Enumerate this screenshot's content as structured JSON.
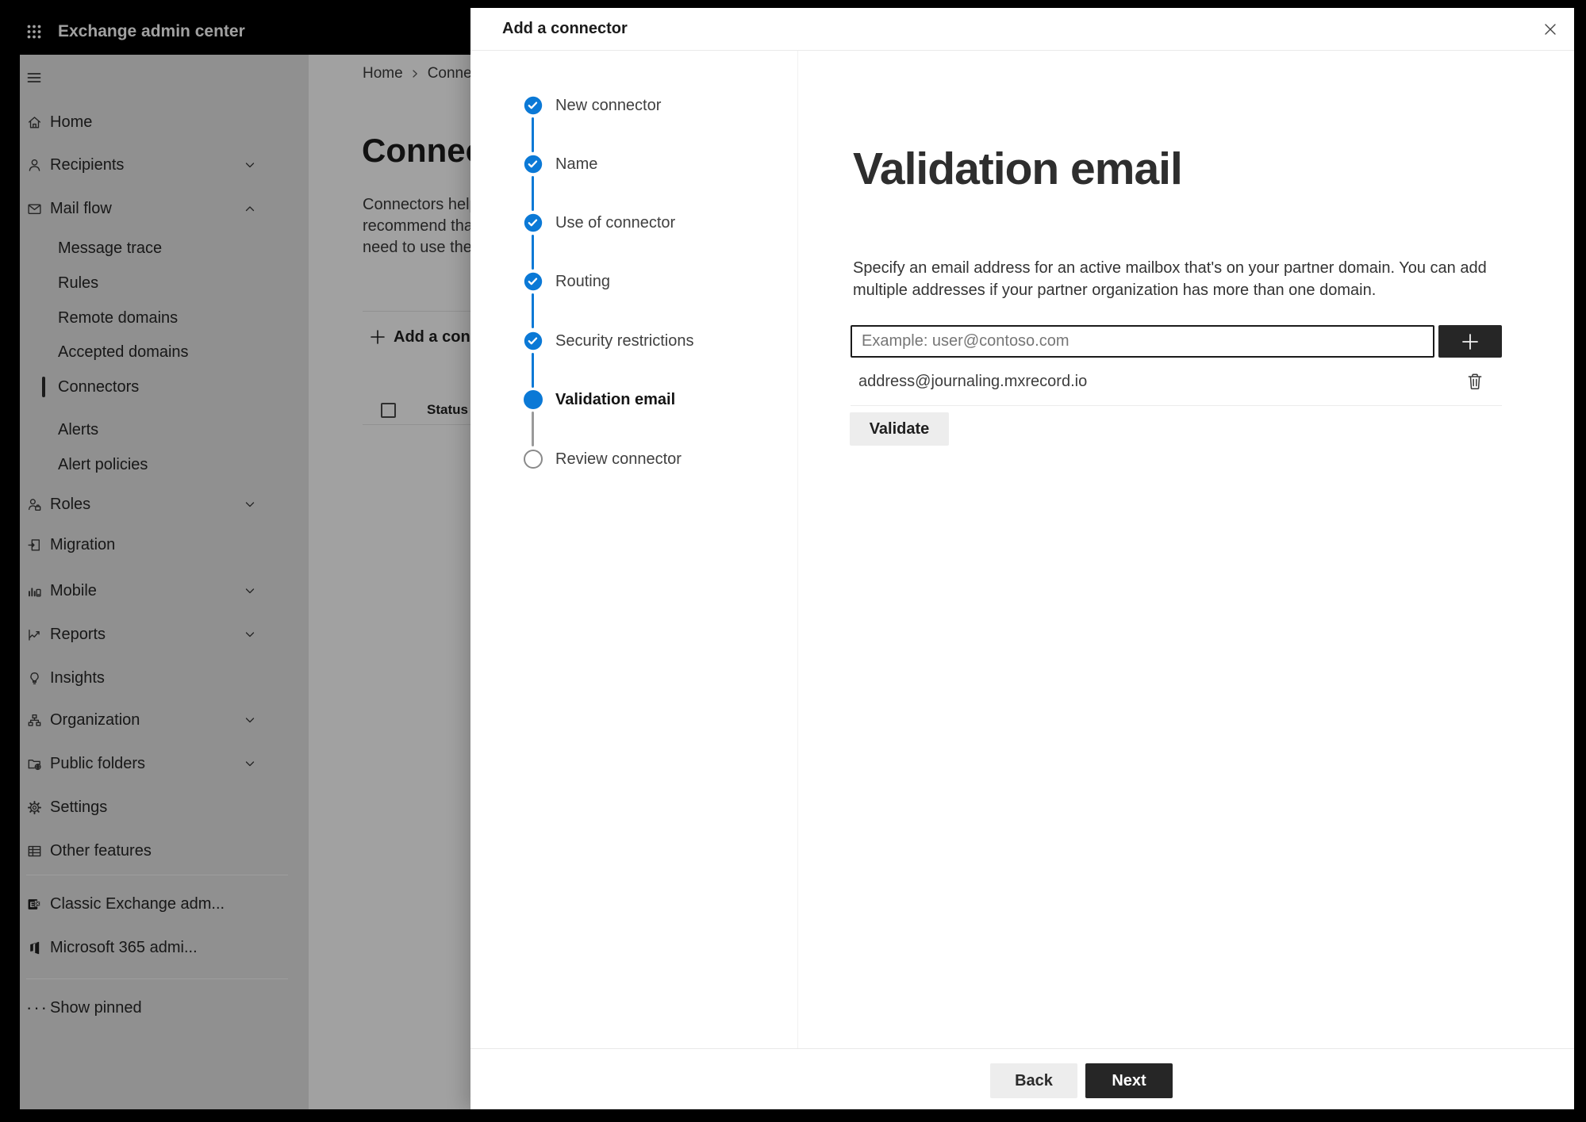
{
  "chrome": {
    "topbar_title": "Exchange admin center"
  },
  "sidebar": {
    "items": [
      {
        "label": "Home",
        "icon": "home-icon"
      },
      {
        "label": "Recipients",
        "icon": "person-icon",
        "chevron": "down"
      },
      {
        "label": "Mail flow",
        "icon": "mail-icon",
        "chevron": "up",
        "expanded": true
      },
      {
        "label": "Message trace",
        "indent": true
      },
      {
        "label": "Rules",
        "indent": true
      },
      {
        "label": "Remote domains",
        "indent": true
      },
      {
        "label": "Accepted domains",
        "indent": true
      },
      {
        "label": "Connectors",
        "indent": true,
        "selected": true
      },
      {
        "label": "Alerts",
        "indent": true
      },
      {
        "label": "Alert policies",
        "indent": true
      },
      {
        "label": "Roles",
        "icon": "roles-icon",
        "chevron": "down"
      },
      {
        "label": "Migration",
        "icon": "migration-icon"
      },
      {
        "label": "Mobile",
        "icon": "mobile-icon",
        "chevron": "down"
      },
      {
        "label": "Reports",
        "icon": "reports-icon",
        "chevron": "down"
      },
      {
        "label": "Insights",
        "icon": "lightbulb-icon"
      },
      {
        "label": "Organization",
        "icon": "org-icon",
        "chevron": "down"
      },
      {
        "label": "Public folders",
        "icon": "folder-globe-icon",
        "chevron": "down"
      },
      {
        "label": "Settings",
        "icon": "gear-icon"
      },
      {
        "label": "Other features",
        "icon": "grid-icon"
      }
    ],
    "footer_items": [
      {
        "label": "Classic Exchange adm...",
        "icon": "exchange-logo-icon"
      },
      {
        "label": "Microsoft 365 admi...",
        "icon": "office-logo-icon"
      }
    ],
    "show_pinned": "Show pinned"
  },
  "background_page": {
    "breadcrumb": {
      "home": "Home",
      "current": "Conne"
    },
    "title_fragment": "Connect",
    "paragraph_lines": [
      "Connectors help",
      "recommend that",
      "need to use ther"
    ],
    "add_button_label": "Add a conn",
    "table": {
      "status_header": "Status"
    }
  },
  "dialog": {
    "title": "Add a connector",
    "steps": [
      {
        "label": "New connector",
        "state": "done"
      },
      {
        "label": "Name",
        "state": "done"
      },
      {
        "label": "Use of connector",
        "state": "done"
      },
      {
        "label": "Routing",
        "state": "done"
      },
      {
        "label": "Security restrictions",
        "state": "done"
      },
      {
        "label": "Validation email",
        "state": "current"
      },
      {
        "label": "Review connector",
        "state": "upcoming"
      }
    ],
    "content": {
      "heading": "Validation email",
      "description": "Specify an email address for an active mailbox that's on your partner domain. You can add multiple addresses if your partner organization has more than one domain.",
      "email_input": {
        "placeholder": "Example: user@contoso.com",
        "value": ""
      },
      "addresses": [
        "address@journaling.mxrecord.io"
      ],
      "validate_button": "Validate"
    },
    "footer": {
      "back": "Back",
      "next": "Next"
    }
  },
  "colors": {
    "accent_blue": "#0b79d6",
    "dark_button": "#262626"
  }
}
